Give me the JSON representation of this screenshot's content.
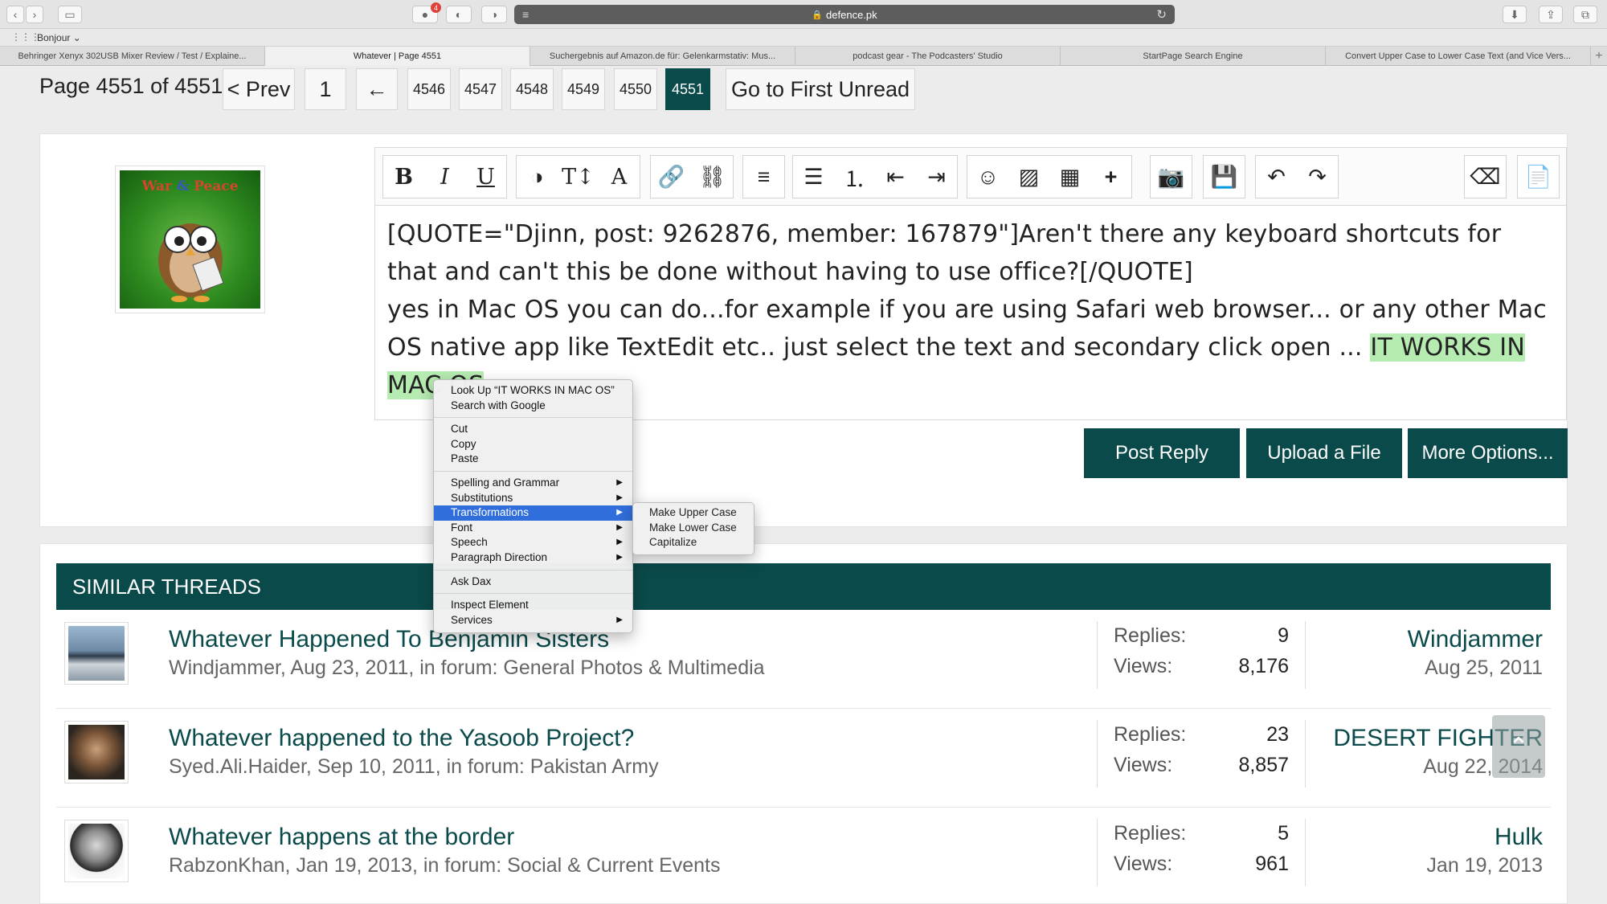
{
  "browser": {
    "url": "defence.pk",
    "bookmarks_label": "Bonjour",
    "extension_badge": "4",
    "tabs": [
      {
        "label": "Behringer Xenyx 302USB Mixer Review / Test / Explaine..."
      },
      {
        "label": "Whatever | Page 4551"
      },
      {
        "label": "Suchergebnis auf Amazon.de für: Gelenkarmstativ: Mus..."
      },
      {
        "label": "podcast gear - The Podcasters' Studio"
      },
      {
        "label": "StartPage Search Engine"
      },
      {
        "label": "Convert Upper Case to Lower Case Text (and Vice Vers..."
      }
    ]
  },
  "pagination": {
    "label": "Page 4551 of 4551",
    "prev": "< Prev",
    "first": "1",
    "jump": "←",
    "pages": [
      "4546",
      "4547",
      "4548",
      "4549",
      "4550",
      "4551"
    ],
    "current": "4551",
    "go_first_unread": "Go to First Unread"
  },
  "avatar": {
    "title_a": "War",
    "title_amp": "&",
    "title_b": "Peace"
  },
  "editor": {
    "line1": "[QUOTE=\"Djinn, post: 9262876, member: 167879\"]Aren't there any keyboard shortcuts for that and can't this be done without having to use office?[/QUOTE]",
    "line2_plain": "yes in Mac OS you can do...for example if you are using Safari web browser... or any other Mac OS native app like TextEdit etc.. just select the text and secondary click open ... ",
    "line2_selected": "IT WORKS IN MAC OS"
  },
  "actions": {
    "post_reply": "Post Reply",
    "upload": "Upload a File",
    "more": "More Options..."
  },
  "context_menu": {
    "lookup": "Look Up “IT WORKS IN MAC OS”",
    "search": "Search with Google",
    "cut": "Cut",
    "copy": "Copy",
    "paste": "Paste",
    "spelling": "Spelling and Grammar",
    "substitutions": "Substitutions",
    "transformations": "Transformations",
    "font": "Font",
    "speech": "Speech",
    "paragraph": "Paragraph Direction",
    "ask": "Ask Dax",
    "inspect": "Inspect Element",
    "services": "Services"
  },
  "submenu": {
    "upper": "Make Upper Case",
    "lower": "Make Lower Case",
    "capitalize": "Capitalize"
  },
  "similar": {
    "heading": "SIMILAR THREADS",
    "replies_label": "Replies:",
    "views_label": "Views:",
    "threads": [
      {
        "title": "Whatever Happened To Benjamin Sisters",
        "meta": "Windjammer, Aug 23, 2011, in forum: General Photos & Multimedia",
        "replies": "9",
        "views": "8,176",
        "last_user": "Windjammer",
        "last_date": "Aug 25, 2011"
      },
      {
        "title": "Whatever happened to the Yasoob Project?",
        "meta": "Syed.Ali.Haider, Sep 10, 2011, in forum: Pakistan Army",
        "replies": "23",
        "views": "8,857",
        "last_user": "DESERT FIGHTER",
        "last_date": "Aug 22, 2014"
      },
      {
        "title": "Whatever happens at the border",
        "meta": "RabzonKhan, Jan 19, 2013, in forum: Social & Current Events",
        "replies": "5",
        "views": "961",
        "last_user": "Hulk",
        "last_date": "Jan 19, 2013"
      }
    ]
  },
  "colors": {
    "accent": "#0b4a4a",
    "selection": "#b6ebb1",
    "menu_highlight": "#2f6edb"
  }
}
